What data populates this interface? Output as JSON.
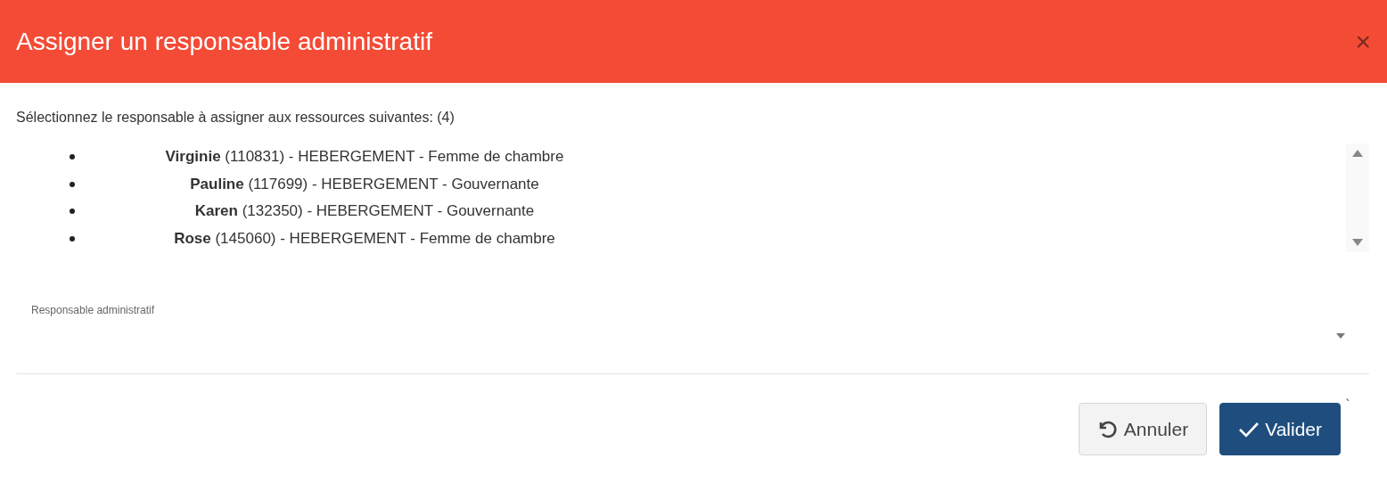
{
  "dialog": {
    "title": "Assigner un responsable administratif",
    "close": "×"
  },
  "intro": "Sélectionnez le responsable à assigner aux ressources suivantes: (4)",
  "resources": [
    {
      "name": "Virginie",
      "details": " (110831) - HEBERGEMENT - Femme de chambre"
    },
    {
      "name": "Pauline",
      "details": " (117699) - HEBERGEMENT - Gouvernante"
    },
    {
      "name": "Karen",
      "details": " (132350) - HEBERGEMENT - Gouvernante"
    },
    {
      "name": "Rose",
      "details": " (145060) - HEBERGEMENT - Femme de chambre"
    }
  ],
  "select": {
    "label": "Responsable administratif"
  },
  "stray_mark": "`",
  "buttons": [
    {
      "kind": "cancel",
      "label": "Annuler"
    },
    {
      "kind": "confirm",
      "label": "Valider"
    }
  ]
}
